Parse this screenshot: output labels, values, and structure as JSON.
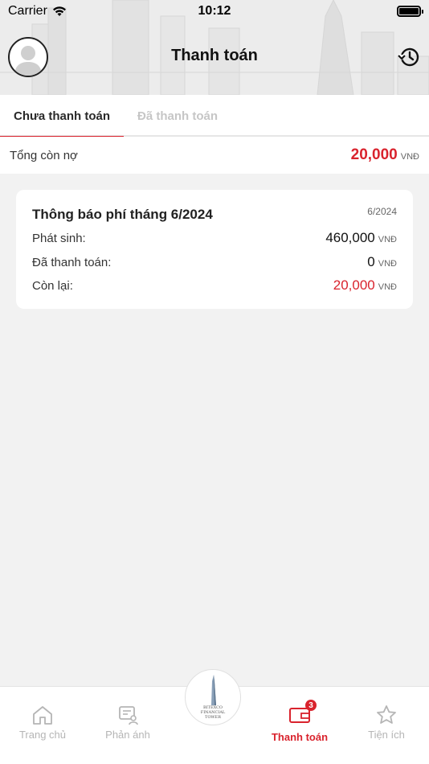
{
  "status_bar": {
    "carrier": "Carrier",
    "time": "10:12"
  },
  "header": {
    "title": "Thanh toán"
  },
  "tabs": [
    {
      "label": "Chưa thanh toán",
      "active": true
    },
    {
      "label": "Đã thanh toán",
      "active": false
    }
  ],
  "total": {
    "label": "Tổng còn nợ",
    "amount": "20,000",
    "unit": "VNĐ"
  },
  "bill": {
    "title": "Thông báo phí tháng 6/2024",
    "period": "6/2024",
    "rows": [
      {
        "label": "Phát sinh:",
        "value": "460,000",
        "unit": "VNĐ"
      },
      {
        "label": "Đã thanh toán:",
        "value": "0",
        "unit": "VNĐ"
      },
      {
        "label": "Còn lại:",
        "value": "20,000",
        "unit": "VNĐ"
      }
    ]
  },
  "bottom_nav": {
    "items": [
      {
        "label": "Trang chủ",
        "icon": "home-icon"
      },
      {
        "label": "Phản ánh",
        "icon": "feedback-icon"
      },
      {
        "label": "Thanh toán",
        "icon": "payment-icon",
        "badge": "3",
        "active": true
      },
      {
        "label": "Tiện ích",
        "icon": "star-icon"
      }
    ],
    "logo_text": [
      "BITEXCO",
      "FINANCIAL",
      "TOWER"
    ]
  },
  "colors": {
    "accent": "#d9232d",
    "inactive": "#b5b5b5"
  }
}
